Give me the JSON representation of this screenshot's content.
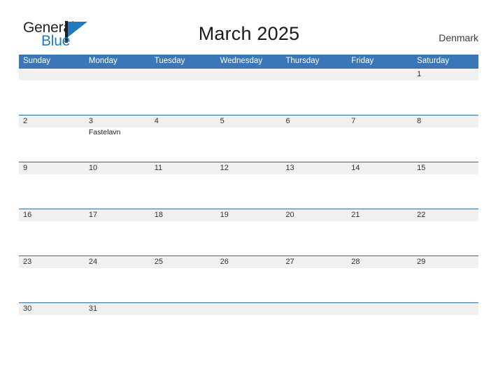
{
  "brand": {
    "name_part1": "General",
    "name_part2": "Blue",
    "mark_icon": "blue-flag-triangle-icon"
  },
  "header": {
    "title": "March 2025",
    "region": "Denmark"
  },
  "colors": {
    "header_blue": "#3a77b8",
    "row_divider_blue": "#2e6da4",
    "day_band_gray": "#f0f0f0",
    "brand_blue": "#1f7ac0",
    "text_dark": "#231f20"
  },
  "calendar": {
    "month": "March",
    "year": "2025",
    "weekday_headers": [
      "Sunday",
      "Monday",
      "Tuesday",
      "Wednesday",
      "Thursday",
      "Friday",
      "Saturday"
    ],
    "weeks": [
      [
        {
          "day": "",
          "events": []
        },
        {
          "day": "",
          "events": []
        },
        {
          "day": "",
          "events": []
        },
        {
          "day": "",
          "events": []
        },
        {
          "day": "",
          "events": []
        },
        {
          "day": "",
          "events": []
        },
        {
          "day": "1",
          "events": []
        }
      ],
      [
        {
          "day": "2",
          "events": []
        },
        {
          "day": "3",
          "events": [
            "Fastelavn"
          ]
        },
        {
          "day": "4",
          "events": []
        },
        {
          "day": "5",
          "events": []
        },
        {
          "day": "6",
          "events": []
        },
        {
          "day": "7",
          "events": []
        },
        {
          "day": "8",
          "events": []
        }
      ],
      [
        {
          "day": "9",
          "events": []
        },
        {
          "day": "10",
          "events": []
        },
        {
          "day": "11",
          "events": []
        },
        {
          "day": "12",
          "events": []
        },
        {
          "day": "13",
          "events": []
        },
        {
          "day": "14",
          "events": []
        },
        {
          "day": "15",
          "events": []
        }
      ],
      [
        {
          "day": "16",
          "events": []
        },
        {
          "day": "17",
          "events": []
        },
        {
          "day": "18",
          "events": []
        },
        {
          "day": "19",
          "events": []
        },
        {
          "day": "20",
          "events": []
        },
        {
          "day": "21",
          "events": []
        },
        {
          "day": "22",
          "events": []
        }
      ],
      [
        {
          "day": "23",
          "events": []
        },
        {
          "day": "24",
          "events": []
        },
        {
          "day": "25",
          "events": []
        },
        {
          "day": "26",
          "events": []
        },
        {
          "day": "27",
          "events": []
        },
        {
          "day": "28",
          "events": []
        },
        {
          "day": "29",
          "events": []
        }
      ],
      [
        {
          "day": "30",
          "events": []
        },
        {
          "day": "31",
          "events": []
        },
        {
          "day": "",
          "events": []
        },
        {
          "day": "",
          "events": []
        },
        {
          "day": "",
          "events": []
        },
        {
          "day": "",
          "events": []
        },
        {
          "day": "",
          "events": []
        }
      ]
    ]
  }
}
